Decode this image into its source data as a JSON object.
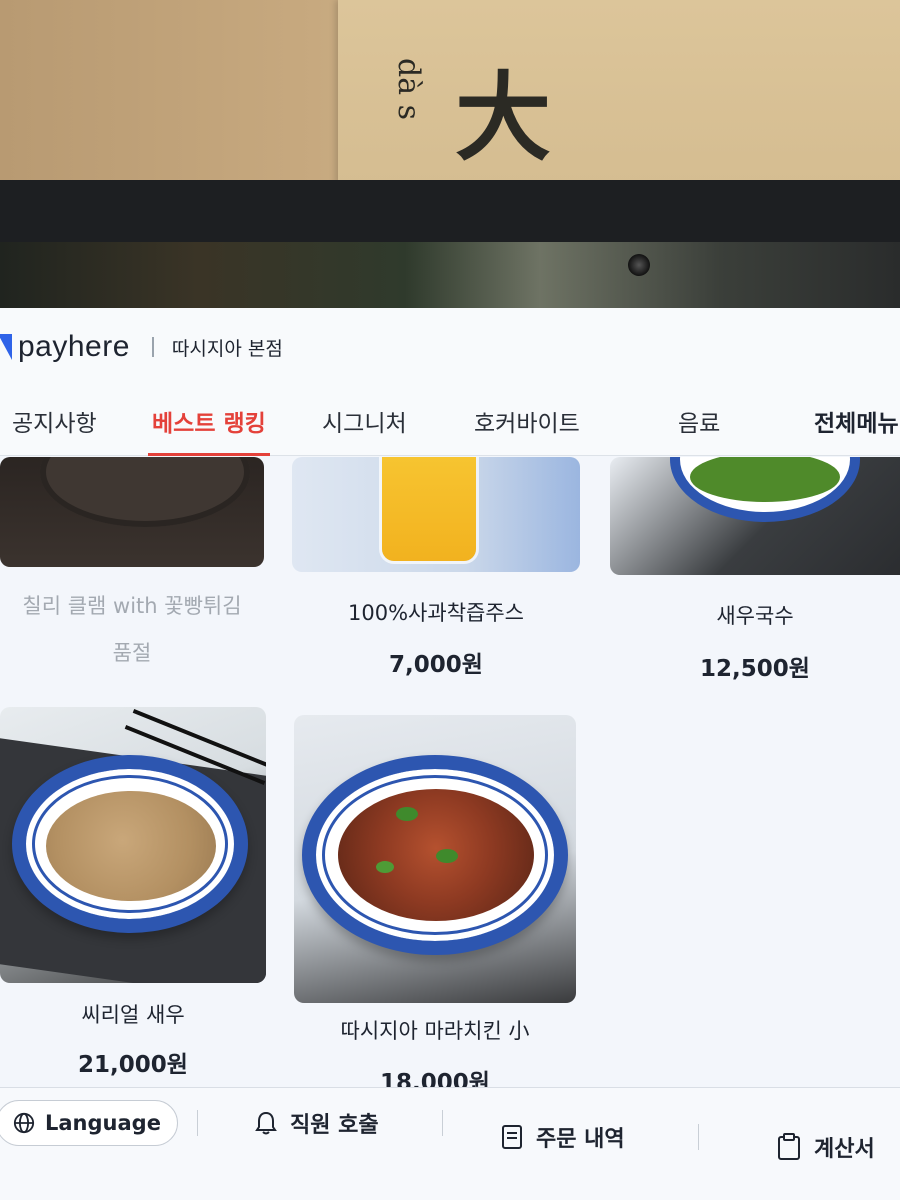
{
  "poster": {
    "hanzi": "大",
    "pinyin": "dà s"
  },
  "header": {
    "brand": "payhere",
    "store": "따시지아 본점"
  },
  "tabs": [
    {
      "label": "공지사항"
    },
    {
      "label": "베스트 랭킹",
      "active": true
    },
    {
      "label": "시그니처"
    },
    {
      "label": "호커바이트"
    },
    {
      "label": "음료"
    },
    {
      "label": "전체메뉴"
    }
  ],
  "menu": [
    {
      "name": "칠리 클램 with 꽃빵튀김",
      "status": "품절"
    },
    {
      "name": "100%사과착즙주스",
      "price": "7,000원"
    },
    {
      "name": "새우국수",
      "price": "12,500원"
    },
    {
      "name": "씨리얼 새우",
      "price": "21,000원"
    },
    {
      "name": "따시지아 마라치킨 小",
      "price": "18,000원"
    }
  ],
  "bottom": {
    "language": "Language",
    "call_staff": "직원 호출",
    "order_history": "주문 내역",
    "checkout": "계산서"
  },
  "colors": {
    "accent": "#e4413a",
    "brand": "#2f63e8",
    "plate_blue": "#2d56b0"
  },
  "icons": [
    "globe-icon",
    "bell-icon",
    "receipt-icon",
    "clipboard-icon"
  ]
}
